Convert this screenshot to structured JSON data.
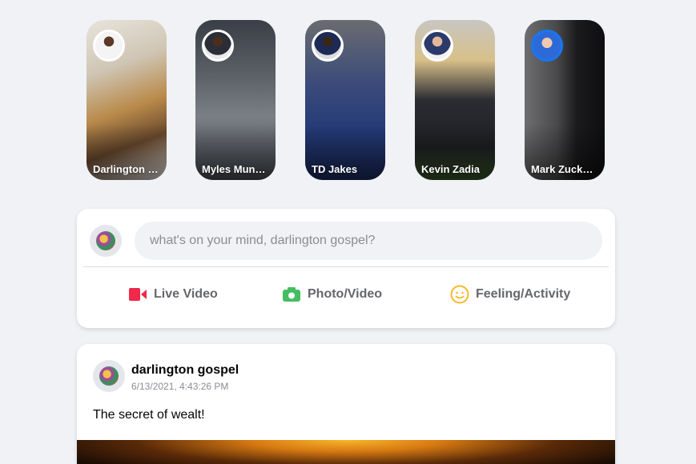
{
  "stories": [
    {
      "name": "Darlington gospel",
      "avatar_icon": "user-avatar-icon"
    },
    {
      "name": "Myles Munroe",
      "avatar_icon": "user-avatar-icon"
    },
    {
      "name": "TD Jakes",
      "avatar_icon": "user-avatar-icon"
    },
    {
      "name": "Kevin Zadia",
      "avatar_icon": "user-avatar-icon"
    },
    {
      "name": "Mark Zuckerberg",
      "avatar_icon": "user-avatar-icon"
    }
  ],
  "composer": {
    "placeholder": "what's on your mind, darlington gospel?",
    "actions": [
      {
        "label": "Live Video",
        "icon": "video-camera-icon",
        "color": "#f02849"
      },
      {
        "label": "Photo/Video",
        "icon": "camera-icon",
        "color": "#45bd62"
      },
      {
        "label": "Feeling/Activity",
        "icon": "smiley-icon",
        "color": "#f7b928"
      }
    ]
  },
  "post": {
    "author": "darlington gospel",
    "timestamp": "6/13/2021, 4:43:26 PM",
    "text": "The secret of wealt!"
  }
}
